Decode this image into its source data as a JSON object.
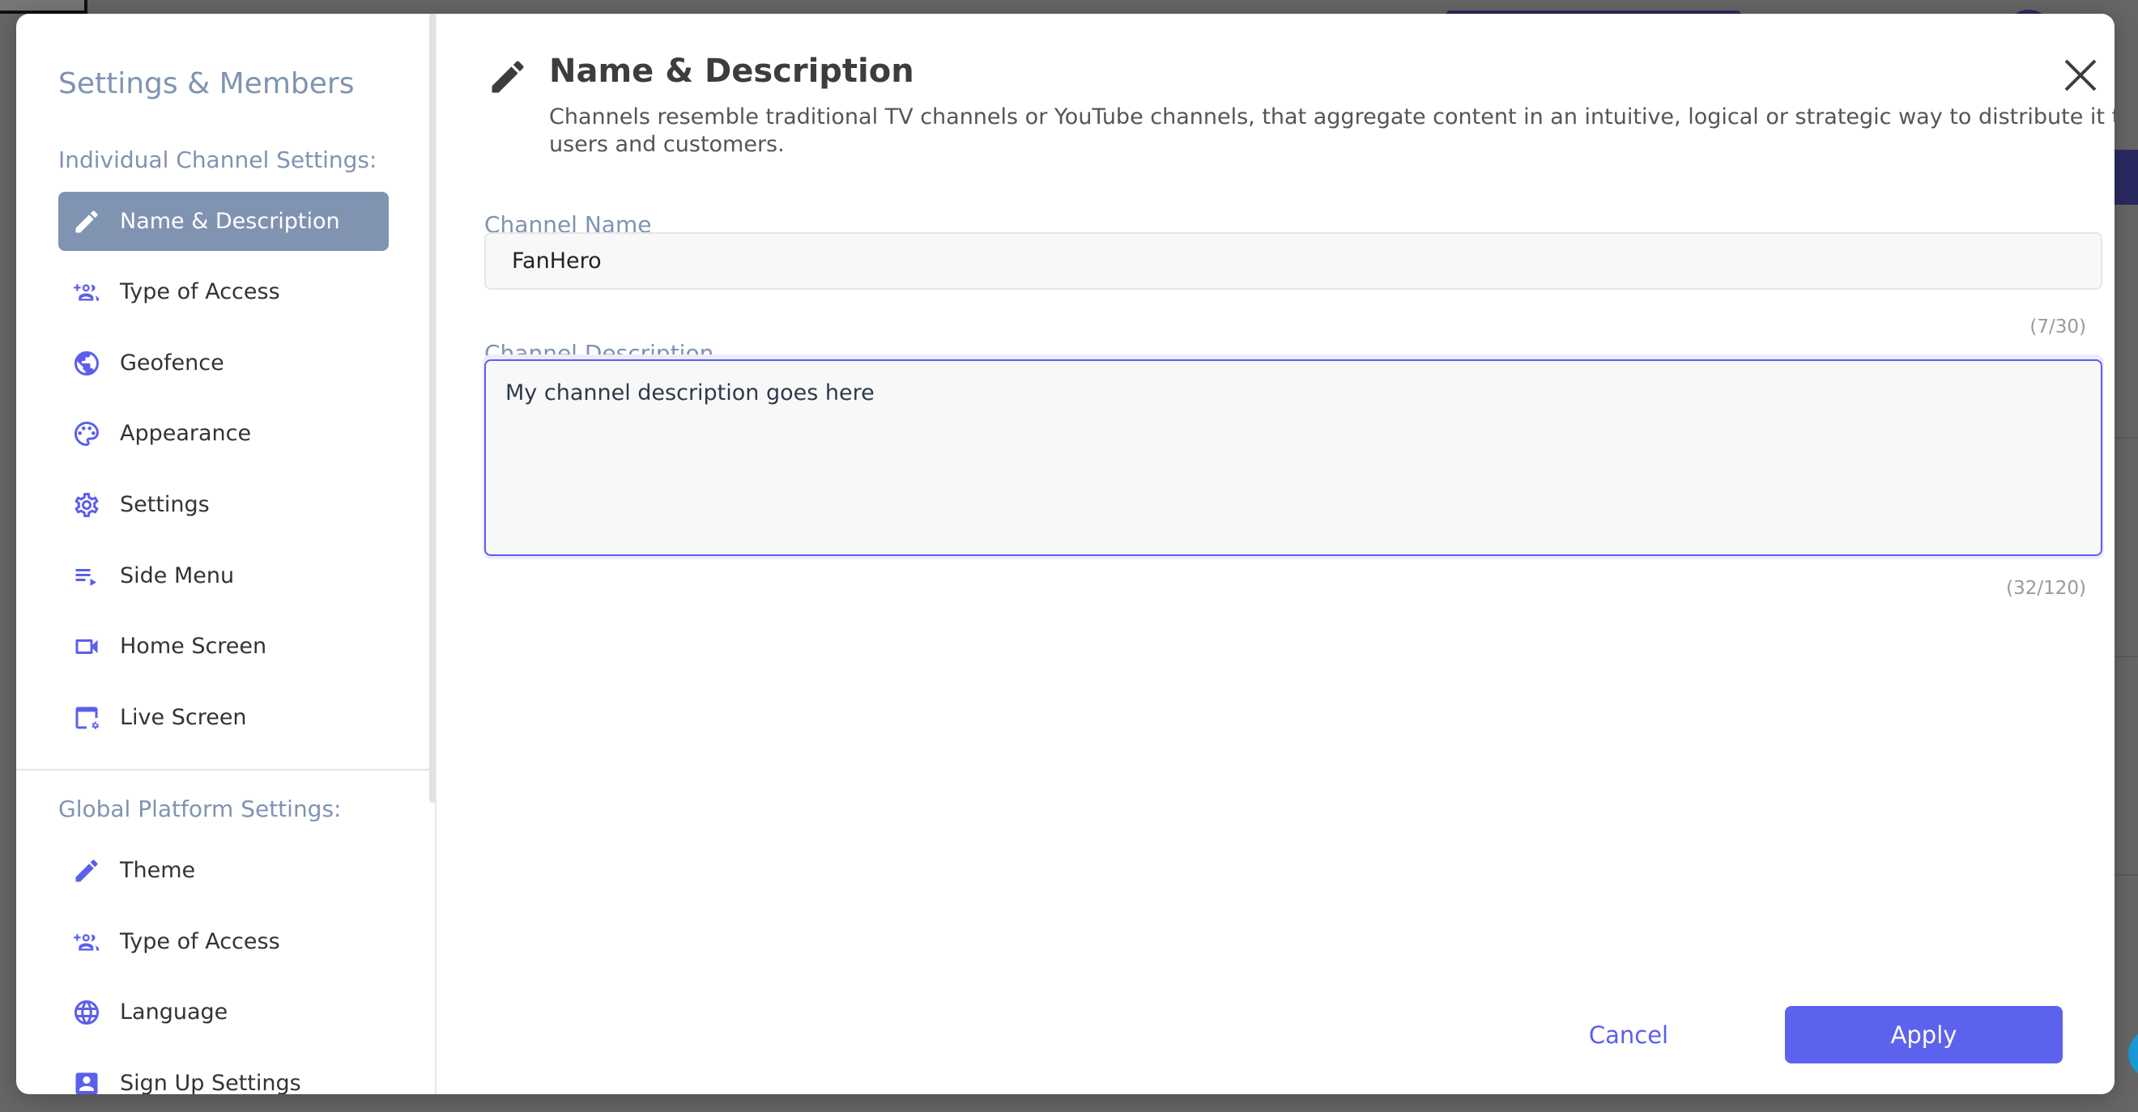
{
  "sidebar": {
    "title": "Settings & Members",
    "individual_section_label": "Individual Channel Settings:",
    "individual_items": [
      {
        "label": "Name & Description",
        "icon": "pencil-icon",
        "active": true
      },
      {
        "label": "Type of Access",
        "icon": "group-add-icon",
        "active": false
      },
      {
        "label": "Geofence",
        "icon": "globe-filled-icon",
        "active": false
      },
      {
        "label": "Appearance",
        "icon": "palette-icon",
        "active": false
      },
      {
        "label": "Settings",
        "icon": "gear-icon",
        "active": false
      },
      {
        "label": "Side Menu",
        "icon": "menu-play-icon",
        "active": false
      },
      {
        "label": "Home Screen",
        "icon": "video-camera-icon",
        "active": false
      },
      {
        "label": "Live Screen",
        "icon": "screen-settings-icon",
        "active": false
      }
    ],
    "global_section_label": "Global Platform Settings:",
    "global_items": [
      {
        "label": "Theme",
        "icon": "pencil-icon"
      },
      {
        "label": "Type of Access",
        "icon": "group-add-icon"
      },
      {
        "label": "Language",
        "icon": "language-globe-icon"
      },
      {
        "label": "Sign Up Settings",
        "icon": "account-box-icon"
      }
    ]
  },
  "main": {
    "title": "Name & Description",
    "description": "Channels resemble traditional TV channels or YouTube channels, that aggregate content in an intuitive, logical or strategic way to distribute it to users and customers.",
    "channel_name": {
      "label": "Channel Name",
      "value": "FanHero",
      "counter": "(7/30)"
    },
    "channel_description": {
      "label": "Channel Description",
      "value": "My channel description goes here",
      "counter": "(32/120)"
    },
    "cancel_label": "Cancel",
    "apply_label": "Apply"
  },
  "colors": {
    "accent": "#5d62ee",
    "sidebar_heading": "#8093b1",
    "active_item_bg": "#8093b1"
  }
}
